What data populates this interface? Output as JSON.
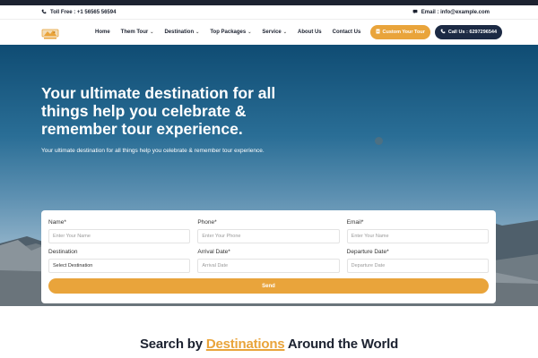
{
  "info_bar": {
    "toll_free": "Toll Free : +1 56565 56594",
    "email": "Email : info@example.com"
  },
  "nav": {
    "items": [
      {
        "label": "Home",
        "has_caret": false
      },
      {
        "label": "Them Tour",
        "has_caret": true
      },
      {
        "label": "Destination",
        "has_caret": true
      },
      {
        "label": "Top Packages",
        "has_caret": true
      },
      {
        "label": "Service",
        "has_caret": true
      },
      {
        "label": "About Us",
        "has_caret": false
      },
      {
        "label": "Contact Us",
        "has_caret": false
      }
    ],
    "custom_tour": "Custom Your Tour",
    "call_us": "Call Us : 6297296544"
  },
  "hero": {
    "title": "Your ultimate destination for all things help you celebrate & remember tour experience.",
    "subtitle": "Your ultimate destination for all things help you celebrate & remember tour experience."
  },
  "form": {
    "name_label": "Name*",
    "name_placeholder": "Enter Your Name",
    "phone_label": "Phone*",
    "phone_placeholder": "Enter Your Phone",
    "email_label": "Email*",
    "email_placeholder": "Enter Your Name",
    "destination_label": "Destination",
    "destination_value": "Select Destination",
    "arrival_label": "Arrival Date*",
    "arrival_placeholder": "Arrival Date",
    "departure_label": "Departure Date*",
    "departure_placeholder": "Departure Date",
    "send": "Send"
  },
  "section": {
    "prefix": "Search by ",
    "highlight": "Destinations",
    "suffix": " Around the World"
  },
  "colors": {
    "accent": "#e9a43b",
    "dark": "#1c2a44"
  },
  "icons": [
    "phone-icon",
    "chat-icon",
    "logo-icon",
    "document-icon",
    "phone-call-icon",
    "chevron-down-icon"
  ]
}
